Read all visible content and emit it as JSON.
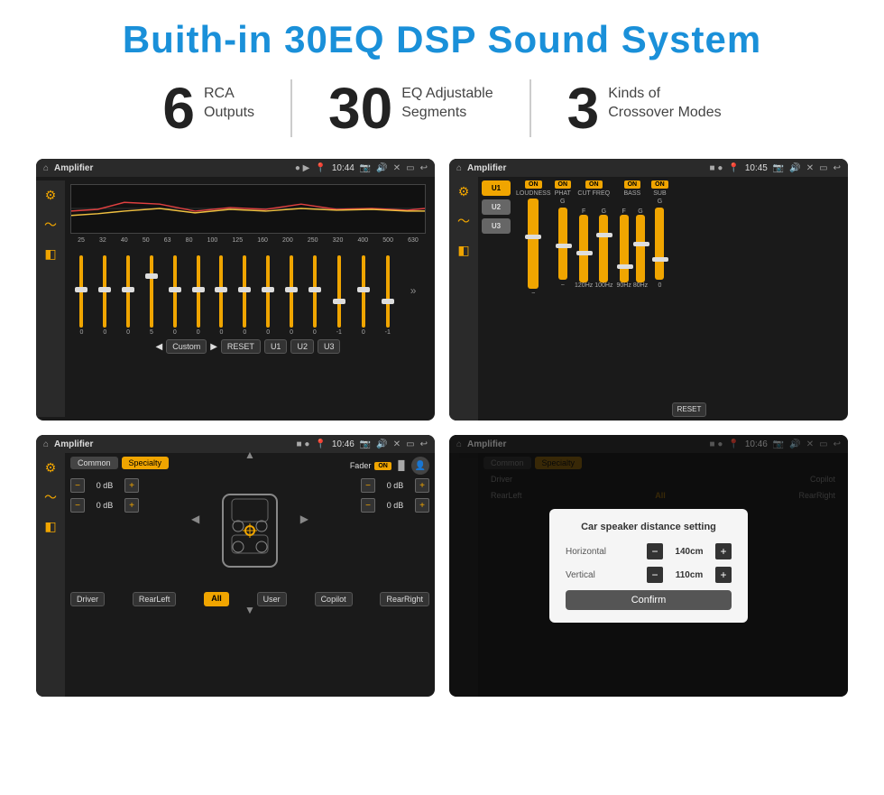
{
  "title": "Buith-in 30EQ DSP Sound System",
  "stats": [
    {
      "number": "6",
      "label_line1": "RCA",
      "label_line2": "Outputs"
    },
    {
      "number": "30",
      "label_line1": "EQ Adjustable",
      "label_line2": "Segments"
    },
    {
      "number": "3",
      "label_line1": "Kinds of",
      "label_line2": "Crossover Modes"
    }
  ],
  "screens": [
    {
      "id": "eq-screen",
      "title": "Amplifier",
      "time": "10:44",
      "type": "eq"
    },
    {
      "id": "amp-screen",
      "title": "Amplifier",
      "time": "10:45",
      "type": "amplifier"
    },
    {
      "id": "fader-screen",
      "title": "Amplifier",
      "time": "10:46",
      "type": "fader"
    },
    {
      "id": "dialog-screen",
      "title": "Amplifier",
      "time": "10:46",
      "type": "fader-dialog",
      "dialog": {
        "title": "Car speaker distance setting",
        "horizontal_label": "Horizontal",
        "horizontal_value": "140cm",
        "vertical_label": "Vertical",
        "vertical_value": "110cm",
        "confirm_label": "Confirm"
      }
    }
  ],
  "eq_freqs": [
    "25",
    "32",
    "40",
    "50",
    "63",
    "80",
    "100",
    "125",
    "160",
    "200",
    "250",
    "320",
    "400",
    "500",
    "630"
  ],
  "eq_values": [
    "0",
    "0",
    "0",
    "5",
    "0",
    "0",
    "0",
    "0",
    "0",
    "0",
    "0",
    "-1",
    "0",
    "-1"
  ],
  "eq_buttons": [
    "Custom",
    "RESET",
    "U1",
    "U2",
    "U3"
  ],
  "amp_presets": [
    "U1",
    "U2",
    "U3"
  ],
  "amp_controls": [
    {
      "label": "LOUDNESS",
      "on": true
    },
    {
      "label": "PHAT",
      "on": true
    },
    {
      "label": "CUT FREQ",
      "on": true
    },
    {
      "label": "BASS",
      "on": true
    },
    {
      "label": "SUB",
      "on": true
    }
  ],
  "fader_tabs": [
    "Common",
    "Specialty"
  ],
  "fader_label": "Fader",
  "fader_on": "ON",
  "fader_bottom_btns": [
    "Driver",
    "RearLeft",
    "All",
    "User",
    "Copilot",
    "RearRight"
  ]
}
